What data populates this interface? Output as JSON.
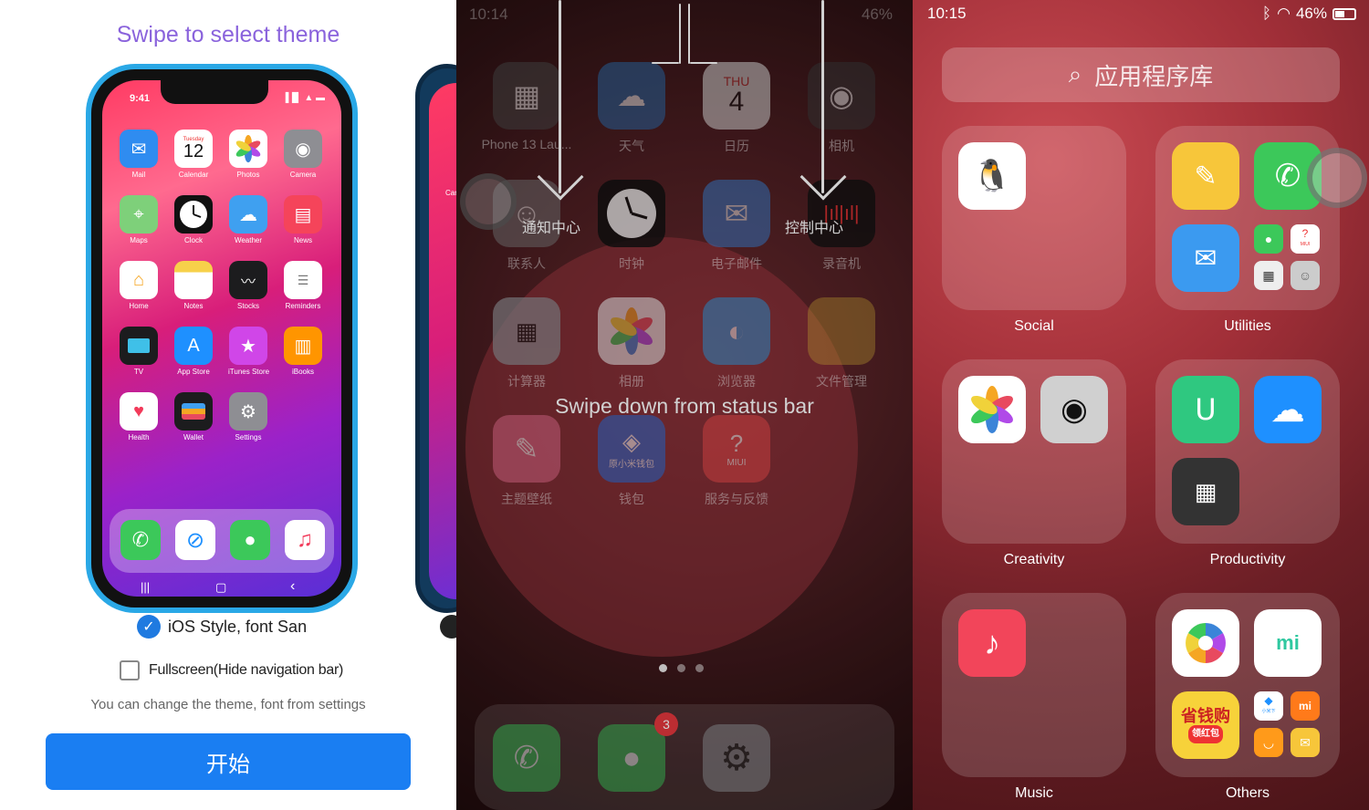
{
  "panel1": {
    "title": "Swipe to select theme",
    "phone": {
      "time": "9:41",
      "status_icons": "▐▐▌ ▲ ▬",
      "date_icon": {
        "weekday": "Tuesday",
        "day": "12"
      },
      "apps": [
        {
          "label": "Mail",
          "icon": "mail-icon",
          "color": "#2f8cf0"
        },
        {
          "label": "Calendar",
          "icon": "calendar-icon",
          "color": "#ffffff"
        },
        {
          "label": "Photos",
          "icon": "photos-icon",
          "color": "#ffffff"
        },
        {
          "label": "Camera",
          "icon": "camera-icon",
          "color": "#8e8e93"
        },
        {
          "label": "Maps",
          "icon": "maps-icon",
          "color": "#7ed07a"
        },
        {
          "label": "Clock",
          "icon": "clock-icon",
          "color": "#111111"
        },
        {
          "label": "Weather",
          "icon": "weather-icon",
          "color": "#3fa0f0"
        },
        {
          "label": "News",
          "icon": "news-icon",
          "color": "#f5445a"
        },
        {
          "label": "Home",
          "icon": "home-icon",
          "color": "#ffffff"
        },
        {
          "label": "Notes",
          "icon": "notes-icon",
          "color": "#fff7d6"
        },
        {
          "label": "Stocks",
          "icon": "stocks-icon",
          "color": "#1c1c1e"
        },
        {
          "label": "Reminders",
          "icon": "reminders-icon",
          "color": "#ffffff"
        },
        {
          "label": "TV",
          "icon": "tv-icon",
          "color": "#1c1c1e"
        },
        {
          "label": "App Store",
          "icon": "appstore-icon",
          "color": "#1e90ff"
        },
        {
          "label": "iTunes Store",
          "icon": "itunes-icon",
          "color": "#d046e8"
        },
        {
          "label": "iBooks",
          "icon": "ibooks-icon",
          "color": "#ff9500"
        },
        {
          "label": "Health",
          "icon": "health-icon",
          "color": "#ffffff"
        },
        {
          "label": "Wallet",
          "icon": "wallet-icon",
          "color": "#1c1c1e"
        },
        {
          "label": "Settings",
          "icon": "settings-icon",
          "color": "#8e8e93"
        }
      ],
      "dock": [
        {
          "icon": "phone-icon",
          "color": "#3cc85a"
        },
        {
          "icon": "safari-icon",
          "color": "#ffffff"
        },
        {
          "icon": "messages-icon",
          "color": "#3cc85a"
        },
        {
          "icon": "music-icon",
          "color": "#ffffff"
        }
      ],
      "nav": {
        "recent": "|||",
        "home": "▢",
        "back": "‹"
      }
    },
    "option_ios": "iOS Style, font San",
    "option_fullscreen": "Fullscreen(Hide navigation bar)",
    "note": "You can change the theme, font from settings",
    "start_button": "开始",
    "peek_label": "Can"
  },
  "panel2": {
    "time": "10:14",
    "battery": "46%",
    "apps": [
      {
        "label": "Phone 13 Lau...",
        "icon": "launcher-icon",
        "color": "#4a4a4a"
      },
      {
        "label": "天气",
        "icon": "weather-icon",
        "color": "#2b6fb0"
      },
      {
        "label": "日历",
        "icon": "calendar-icon",
        "color": "#e8e8e8",
        "weekday": "THU",
        "day": "4"
      },
      {
        "label": "相机",
        "icon": "camera-icon",
        "color": "#3a3a3a"
      },
      {
        "label": "联系人",
        "icon": "contacts-icon",
        "color": "#7a7a7a"
      },
      {
        "label": "时钟",
        "icon": "clock-icon",
        "color": "#111111"
      },
      {
        "label": "电子邮件",
        "icon": "email-icon",
        "color": "#3b84d8"
      },
      {
        "label": "录音机",
        "icon": "recorder-icon",
        "color": "#111111"
      },
      {
        "label": "计算器",
        "icon": "calculator-icon",
        "color": "#8e8e93"
      },
      {
        "label": "相册",
        "icon": "photos-icon",
        "color": "#f2f2f2"
      },
      {
        "label": "浏览器",
        "icon": "browser-icon",
        "color": "#2fa0e8"
      },
      {
        "label": "文件管理",
        "icon": "folder-icon",
        "color": "#e8c23a"
      },
      {
        "label": "主题壁纸",
        "icon": "theme-icon",
        "color": "#e06a8a"
      },
      {
        "label": "钱包",
        "icon": "wallet-icon",
        "color": "#2f6fd8",
        "sub": "原小米钱包"
      },
      {
        "label": "服务与反馈",
        "icon": "feedback-icon",
        "color": "#e84a4a",
        "sub": "MIUI"
      }
    ],
    "left_hint": "通知中心",
    "right_hint": "控制中心",
    "instruction": "Swipe down from status bar",
    "dock": [
      {
        "icon": "phone-icon",
        "color": "#3cc85a"
      },
      {
        "icon": "messages-icon",
        "color": "#3cc85a"
      },
      {
        "icon": "settings-icon",
        "color": "#8e8e93"
      }
    ],
    "badge": "3"
  },
  "panel3": {
    "time": "10:15",
    "battery": "46%",
    "search_placeholder": "应用程序库",
    "folders": [
      {
        "label": "Social"
      },
      {
        "label": "Utilities"
      },
      {
        "label": "Creativity"
      },
      {
        "label": "Productivity"
      },
      {
        "label": "Music"
      },
      {
        "label": "Others"
      }
    ],
    "small_texts": {
      "miui": "MIUI",
      "mi": "mi",
      "shengqiangou": "省钱购",
      "lingqu": "领红包",
      "xiaomi_down": "小米下"
    }
  }
}
